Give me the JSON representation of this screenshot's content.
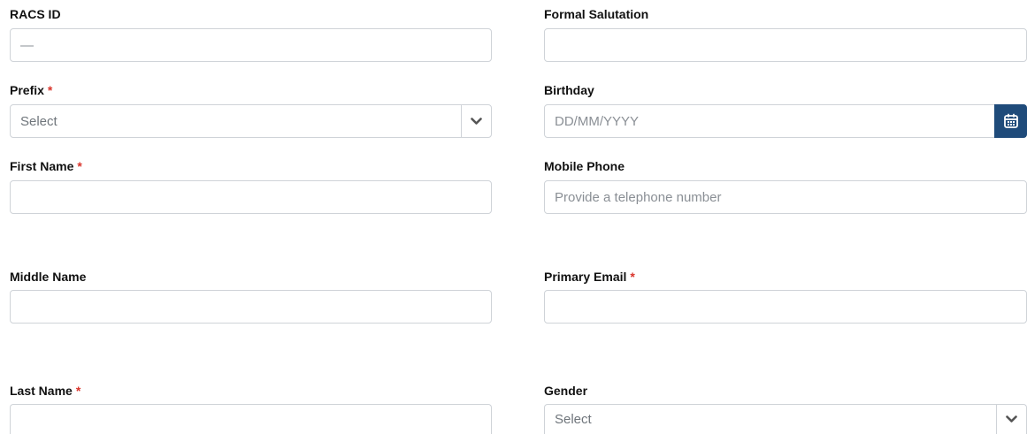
{
  "form": {
    "racs_id": {
      "label": "RACS ID",
      "value": "—"
    },
    "formal_salutation": {
      "label": "Formal Salutation",
      "value": ""
    },
    "prefix": {
      "label": "Prefix",
      "required_mark": "*",
      "selected": "Select"
    },
    "birthday": {
      "label": "Birthday",
      "placeholder": "DD/MM/YYYY"
    },
    "first_name": {
      "label": "First Name",
      "required_mark": "*",
      "value": ""
    },
    "mobile_phone": {
      "label": "Mobile Phone",
      "placeholder": "Provide a telephone number"
    },
    "middle_name": {
      "label": "Middle Name",
      "value": ""
    },
    "primary_email": {
      "label": "Primary Email",
      "required_mark": "*",
      "value": ""
    },
    "last_name": {
      "label": "Last Name",
      "required_mark": "*",
      "value": ""
    },
    "gender": {
      "label": "Gender",
      "selected": "Select"
    }
  },
  "icons": {
    "select_arrow": "chevron-down-icon",
    "date_picker": "calendar-icon"
  },
  "colors": {
    "required": "#d9342b",
    "calendar_button": "#1f4b7a",
    "border": "#cfd3d8"
  }
}
